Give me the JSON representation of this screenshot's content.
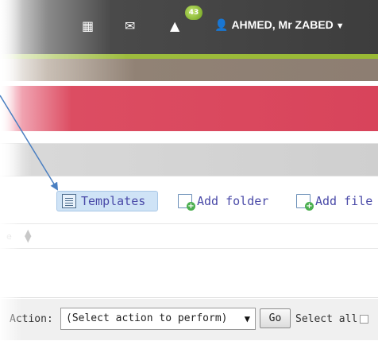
{
  "topbar": {
    "icons": [
      "calendar-icon",
      "mail-icon",
      "alert-icon"
    ],
    "notification_count": "43",
    "user_name": "AHMED, Mr ZABED",
    "user_icon": "person-icon",
    "caret_icon": "caret-down-icon"
  },
  "toolbar": {
    "templates_label": "Templates",
    "add_folder_label": "Add folder",
    "add_file_label": "Add file"
  },
  "table": {
    "column_fragment": "e"
  },
  "action_bar": {
    "label": "Action:",
    "select_value": "(Select action to perform)",
    "go_label": "Go",
    "select_all_label": "Select all"
  },
  "colors": {
    "topbar": "#3d3d3d",
    "accent_green": "#99b934",
    "brown_bar": "#8d7e72",
    "red_bar": "#d8445b",
    "grey_bar": "#cfcfcf",
    "link": "#4a4aa8",
    "arrow": "#4a7fc1"
  }
}
